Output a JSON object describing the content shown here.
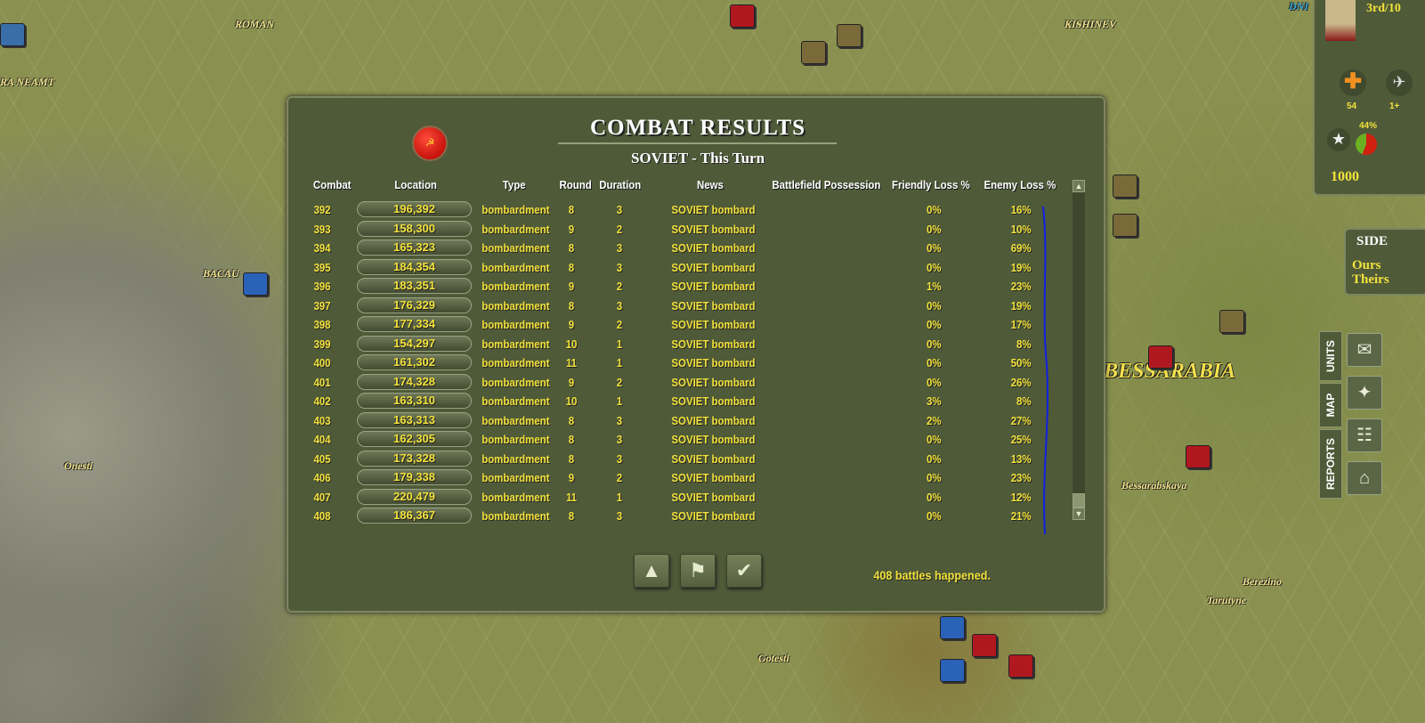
{
  "map": {
    "labels": [
      "ROMAN",
      "KISHINEV",
      "RA NEAMT",
      "BACAU",
      "Onesti",
      "BESSARABIA",
      "Bessarabskaya",
      "Berezino",
      "Tarutyne",
      "Gotesti",
      "DNI"
    ]
  },
  "dialog": {
    "title": "COMBAT RESULTS",
    "subtitle": "SOVIET - This Turn",
    "columns": [
      "Combat",
      "Location",
      "Type",
      "Round",
      "Duration",
      "News",
      "Battlefield Possession",
      "Friendly Loss %",
      "Enemy Loss %"
    ],
    "rows": [
      [
        "392",
        "196,392",
        "bombardment",
        "8",
        "3",
        "SOVIET bombard",
        "",
        "0%",
        "16%"
      ],
      [
        "393",
        "158,300",
        "bombardment",
        "9",
        "2",
        "SOVIET bombard",
        "",
        "0%",
        "10%"
      ],
      [
        "394",
        "165,323",
        "bombardment",
        "8",
        "3",
        "SOVIET bombard",
        "",
        "0%",
        "69%"
      ],
      [
        "395",
        "184,354",
        "bombardment",
        "8",
        "3",
        "SOVIET bombard",
        "",
        "0%",
        "19%"
      ],
      [
        "396",
        "183,351",
        "bombardment",
        "9",
        "2",
        "SOVIET bombard",
        "",
        "1%",
        "23%"
      ],
      [
        "397",
        "176,329",
        "bombardment",
        "8",
        "3",
        "SOVIET bombard",
        "",
        "0%",
        "19%"
      ],
      [
        "398",
        "177,334",
        "bombardment",
        "9",
        "2",
        "SOVIET bombard",
        "",
        "0%",
        "17%"
      ],
      [
        "399",
        "154,297",
        "bombardment",
        "10",
        "1",
        "SOVIET bombard",
        "",
        "0%",
        "8%"
      ],
      [
        "400",
        "161,302",
        "bombardment",
        "11",
        "1",
        "SOVIET bombard",
        "",
        "0%",
        "50%"
      ],
      [
        "401",
        "174,328",
        "bombardment",
        "9",
        "2",
        "SOVIET bombard",
        "",
        "0%",
        "26%"
      ],
      [
        "402",
        "163,310",
        "bombardment",
        "10",
        "1",
        "SOVIET bombard",
        "",
        "3%",
        "8%"
      ],
      [
        "403",
        "163,313",
        "bombardment",
        "8",
        "3",
        "SOVIET bombard",
        "",
        "2%",
        "27%"
      ],
      [
        "404",
        "162,305",
        "bombardment",
        "8",
        "3",
        "SOVIET bombard",
        "",
        "0%",
        "25%"
      ],
      [
        "405",
        "173,328",
        "bombardment",
        "8",
        "3",
        "SOVIET bombard",
        "",
        "0%",
        "13%"
      ],
      [
        "406",
        "179,338",
        "bombardment",
        "9",
        "2",
        "SOVIET bombard",
        "",
        "0%",
        "23%"
      ],
      [
        "407",
        "220,479",
        "bombardment",
        "11",
        "1",
        "SOVIET bombard",
        "",
        "0%",
        "12%"
      ],
      [
        "408",
        "186,367",
        "bombardment",
        "8",
        "3",
        "SOVIET bombard",
        "",
        "0%",
        "21%"
      ]
    ],
    "status": "408 battles happened.",
    "buttons": [
      "up-arrow",
      "flags",
      "checkmark"
    ]
  },
  "hud": {
    "date": "3rd/10",
    "medical": "54",
    "air": "1+",
    "morale_pct": "44%",
    "points": "1000"
  },
  "side": {
    "title": "SIDE",
    "ours": "Ours",
    "theirs": "Theirs"
  },
  "tabs": [
    "UNITS",
    "MAP",
    "REPORTS"
  ]
}
